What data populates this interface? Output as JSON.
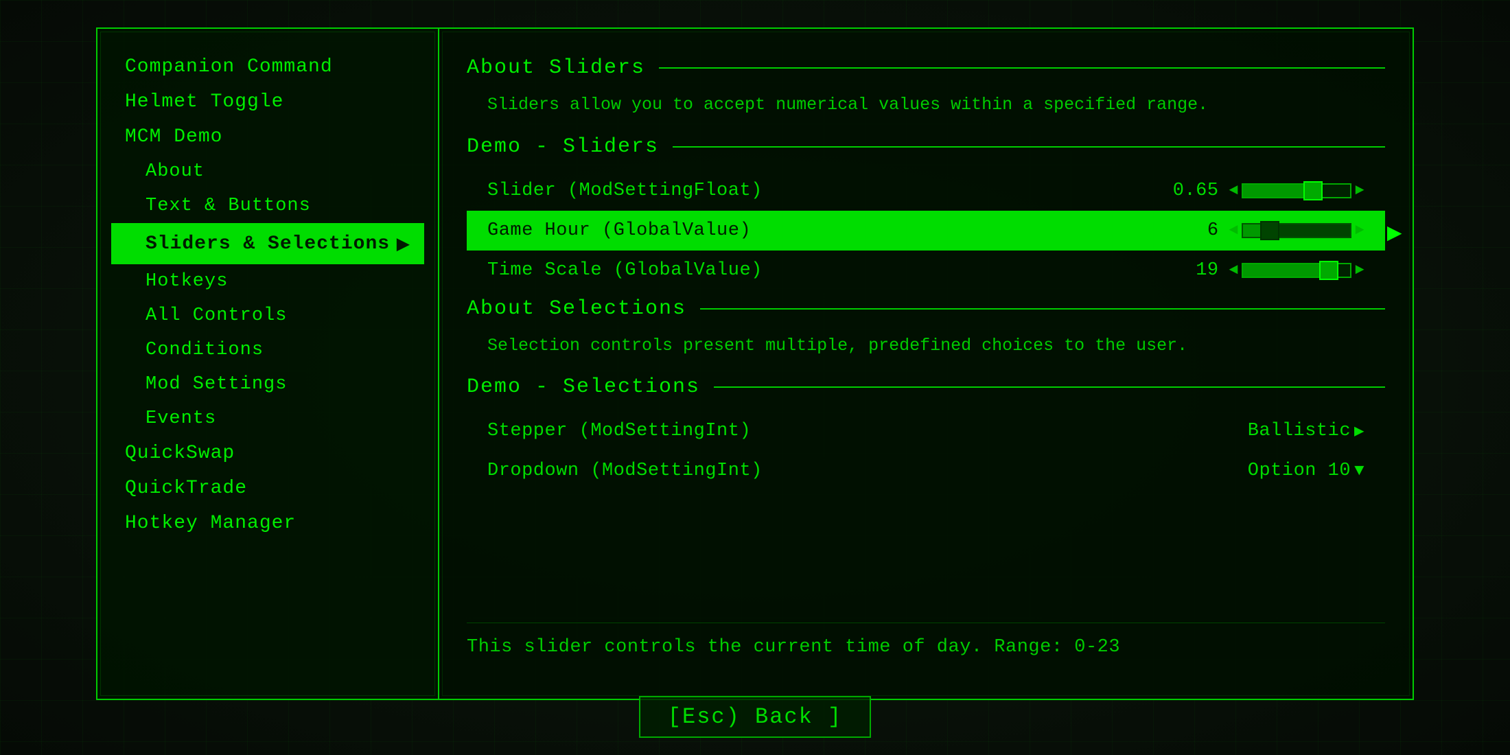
{
  "background": {
    "color": "#0a0f0a"
  },
  "left_panel": {
    "items": [
      {
        "id": "companion-command",
        "label": "Companion Command",
        "type": "top",
        "active": false
      },
      {
        "id": "helmet-toggle",
        "label": "Helmet Toggle",
        "type": "top",
        "active": false
      },
      {
        "id": "mcm-demo",
        "label": "MCM Demo",
        "type": "top",
        "active": false
      },
      {
        "id": "about",
        "label": "About",
        "type": "sub",
        "active": false
      },
      {
        "id": "text-buttons",
        "label": "Text & Buttons",
        "type": "sub",
        "active": false
      },
      {
        "id": "sliders-selections",
        "label": "Sliders & Selections",
        "type": "sub",
        "active": true
      },
      {
        "id": "hotkeys",
        "label": "Hotkeys",
        "type": "sub",
        "active": false
      },
      {
        "id": "all-controls",
        "label": "All Controls",
        "type": "sub",
        "active": false
      },
      {
        "id": "conditions",
        "label": "Conditions",
        "type": "sub",
        "active": false
      },
      {
        "id": "mod-settings",
        "label": "Mod Settings",
        "type": "sub",
        "active": false
      },
      {
        "id": "events",
        "label": "Events",
        "type": "sub",
        "active": false
      },
      {
        "id": "quickswap",
        "label": "QuickSwap",
        "type": "top",
        "active": false
      },
      {
        "id": "quicktrade",
        "label": "QuickTrade",
        "type": "top",
        "active": false
      },
      {
        "id": "hotkey-manager",
        "label": "Hotkey Manager",
        "type": "top",
        "active": false
      }
    ]
  },
  "right_panel": {
    "sections": [
      {
        "id": "about-sliders",
        "header": "About Sliders",
        "description": "Sliders allow you to accept numerical values within a specified range."
      },
      {
        "id": "demo-sliders",
        "header": "Demo - Sliders",
        "settings": [
          {
            "id": "slider-float",
            "label": "Slider (ModSettingFloat)",
            "value": "0.65",
            "type": "slider",
            "fill_pct": 65,
            "thumb_pct": 65,
            "active": false
          },
          {
            "id": "game-hour",
            "label": "Game Hour (GlobalValue)",
            "value": "6",
            "type": "slider",
            "fill_pct": 25,
            "thumb_pct": 25,
            "active": true
          },
          {
            "id": "time-scale",
            "label": "Time Scale (GlobalValue)",
            "value": "19",
            "type": "slider",
            "fill_pct": 80,
            "thumb_pct": 80,
            "active": false
          }
        ]
      },
      {
        "id": "about-selections",
        "header": "About Selections",
        "description": "Selection controls present multiple, predefined choices to the user."
      },
      {
        "id": "demo-selections",
        "header": "Demo - Selections",
        "settings": [
          {
            "id": "stepper",
            "label": "Stepper (ModSettingInt)",
            "value": "Ballistic",
            "type": "stepper",
            "active": false
          },
          {
            "id": "dropdown",
            "label": "Dropdown (ModSettingInt)",
            "value": "Option 10",
            "type": "dropdown",
            "active": false
          }
        ]
      }
    ],
    "tooltip": "This slider controls the current time of day. Range: 0-23"
  },
  "footer": {
    "back_label": "[Esc) Back ]"
  }
}
